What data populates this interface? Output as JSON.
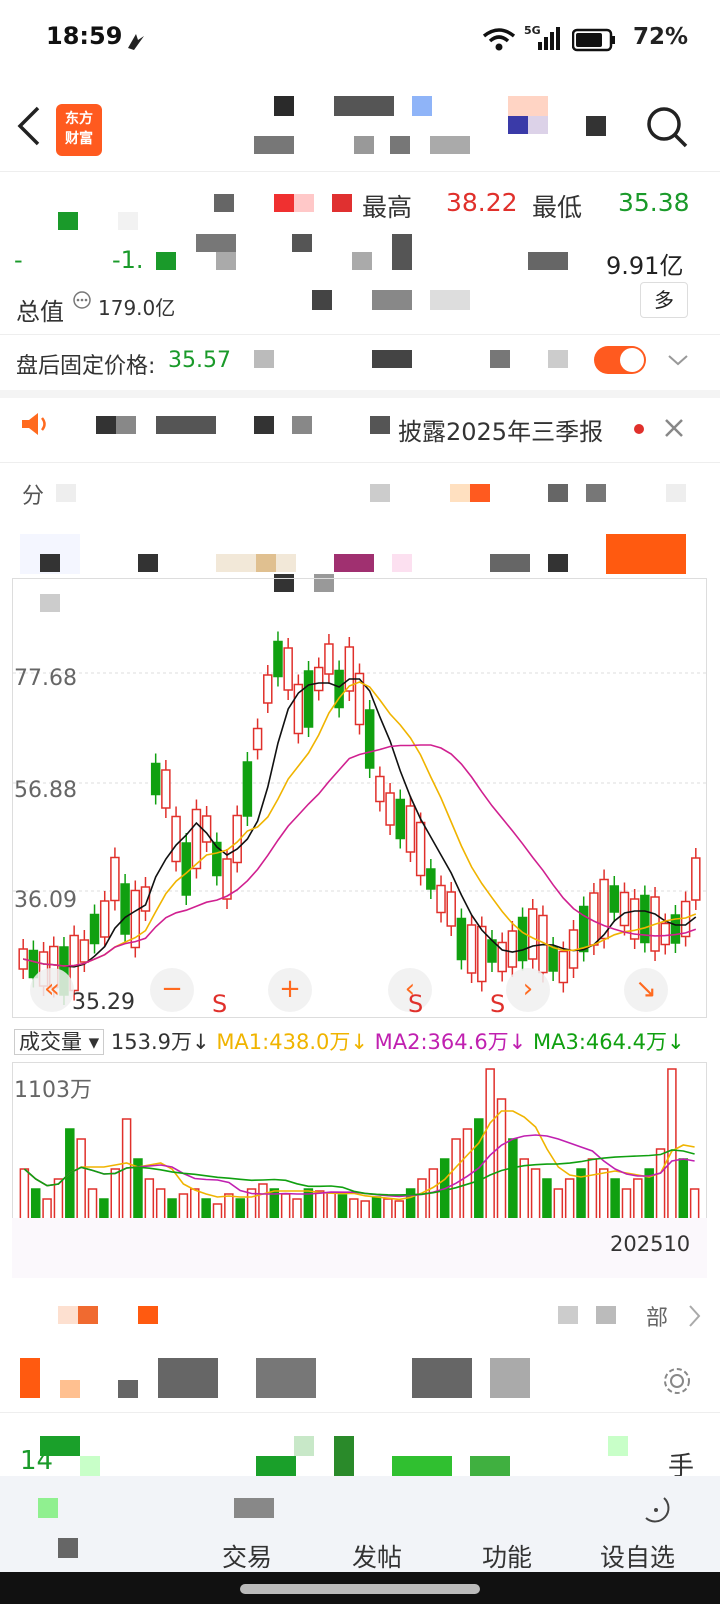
{
  "status": {
    "time": "18:59",
    "battery": "72%",
    "network": "5G"
  },
  "header": {
    "logo_text": "东方\n财富"
  },
  "quote": {
    "high_label": "最高",
    "high_value": "38.22",
    "low_label": "最低",
    "low_value": "35.38",
    "amount_value": "9.91亿",
    "change_pct": "-",
    "change_val": "-1.",
    "market_cap_label": "总值",
    "market_cap_value": "179.0亿",
    "more_label": "多",
    "after_hours_label": "盘后固定价格:",
    "after_hours_value": "35.57"
  },
  "notice": {
    "text": "披露2025年三季报"
  },
  "chart": {
    "y_labels": [
      "77.68",
      "56.88",
      "36.09"
    ],
    "low_marker": "35.29",
    "colors": {
      "up": "#e0302b",
      "down": "#10a010",
      "ma5": "#111111",
      "ma10": "#f0b400",
      "ma20": "#d02090"
    }
  },
  "volume": {
    "selector_label": "成交量",
    "current": "153.9万↓",
    "ma1": "MA1:438.0万↓",
    "ma2": "MA2:364.6万↓",
    "ma3": "MA3:464.4万↓",
    "max_label": "1103万",
    "date_label": "202510"
  },
  "section": {
    "all_label": "部"
  },
  "row": {
    "num": "14",
    "unit": "手"
  },
  "nav": {
    "items": [
      "交易",
      "发帖",
      "功能",
      "设自选"
    ]
  }
}
